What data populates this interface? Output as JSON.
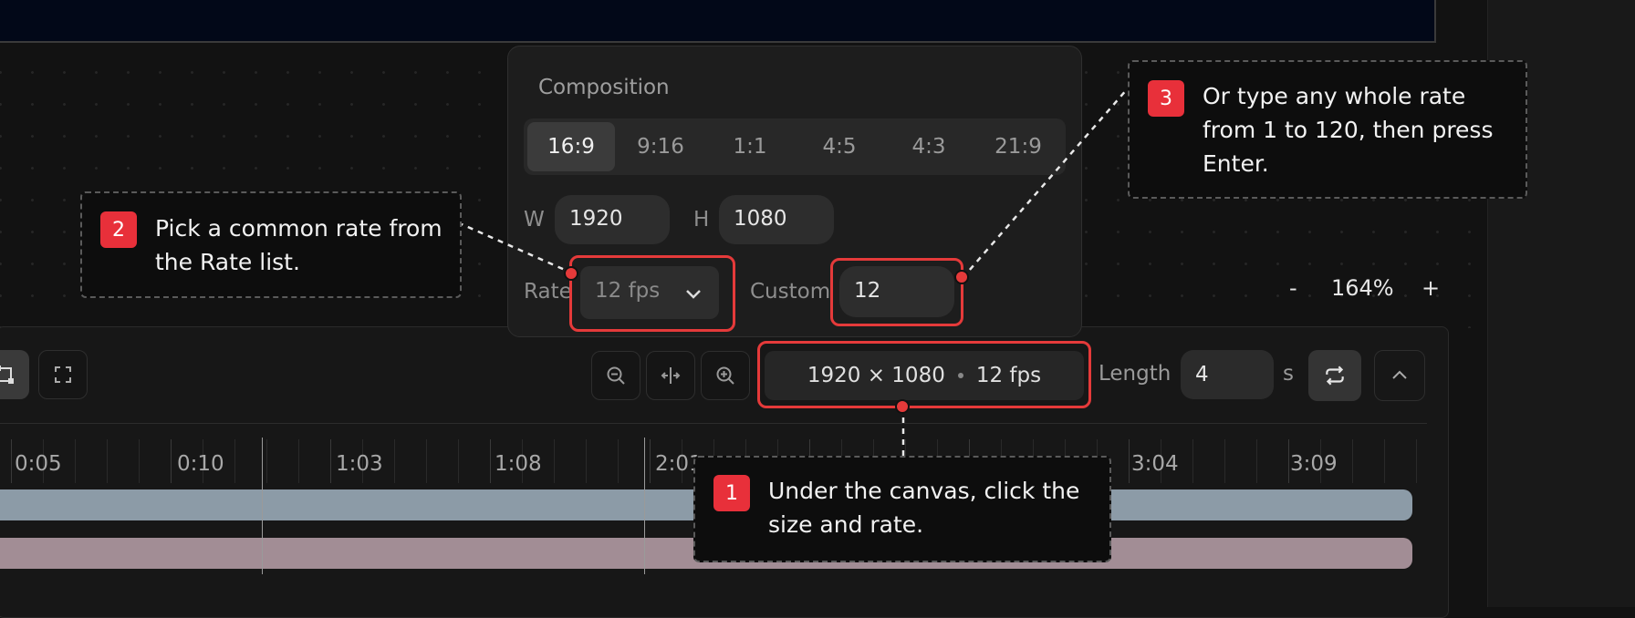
{
  "canvas": {
    "zoom_out_label": "-",
    "zoom_value": "164%",
    "zoom_in_label": "+"
  },
  "toolbar": {
    "size": "1920 × 1080",
    "rate": "12 fps",
    "length_label": "Length",
    "length_value": "4",
    "length_unit": "s"
  },
  "timeline": {
    "tick_labels": [
      "0:05",
      "0:10",
      "1:03",
      "1:08",
      "2:01",
      "3:04",
      "3:09"
    ]
  },
  "composition": {
    "title": "Composition",
    "aspect_options": [
      "16:9",
      "9:16",
      "1:1",
      "4:5",
      "4:3",
      "21:9"
    ],
    "selected_aspect": "16:9",
    "width_label": "W",
    "width_value": "1920",
    "height_label": "H",
    "height_value": "1080",
    "rate_label": "Rate",
    "rate_value": "12 fps",
    "custom_label": "Custom",
    "custom_value": "12"
  },
  "callouts": [
    {
      "number": "1",
      "text": "Under the canvas, click the size and rate."
    },
    {
      "number": "2",
      "text": "Pick a common rate from the Rate list."
    },
    {
      "number": "3",
      "text": "Or type any whole rate from 1 to 120, then press Enter."
    }
  ],
  "colors": {
    "highlight": "#e53a3a",
    "badge": "#e8303a",
    "track1": "#8c9ba7",
    "track2": "#a28d95"
  }
}
